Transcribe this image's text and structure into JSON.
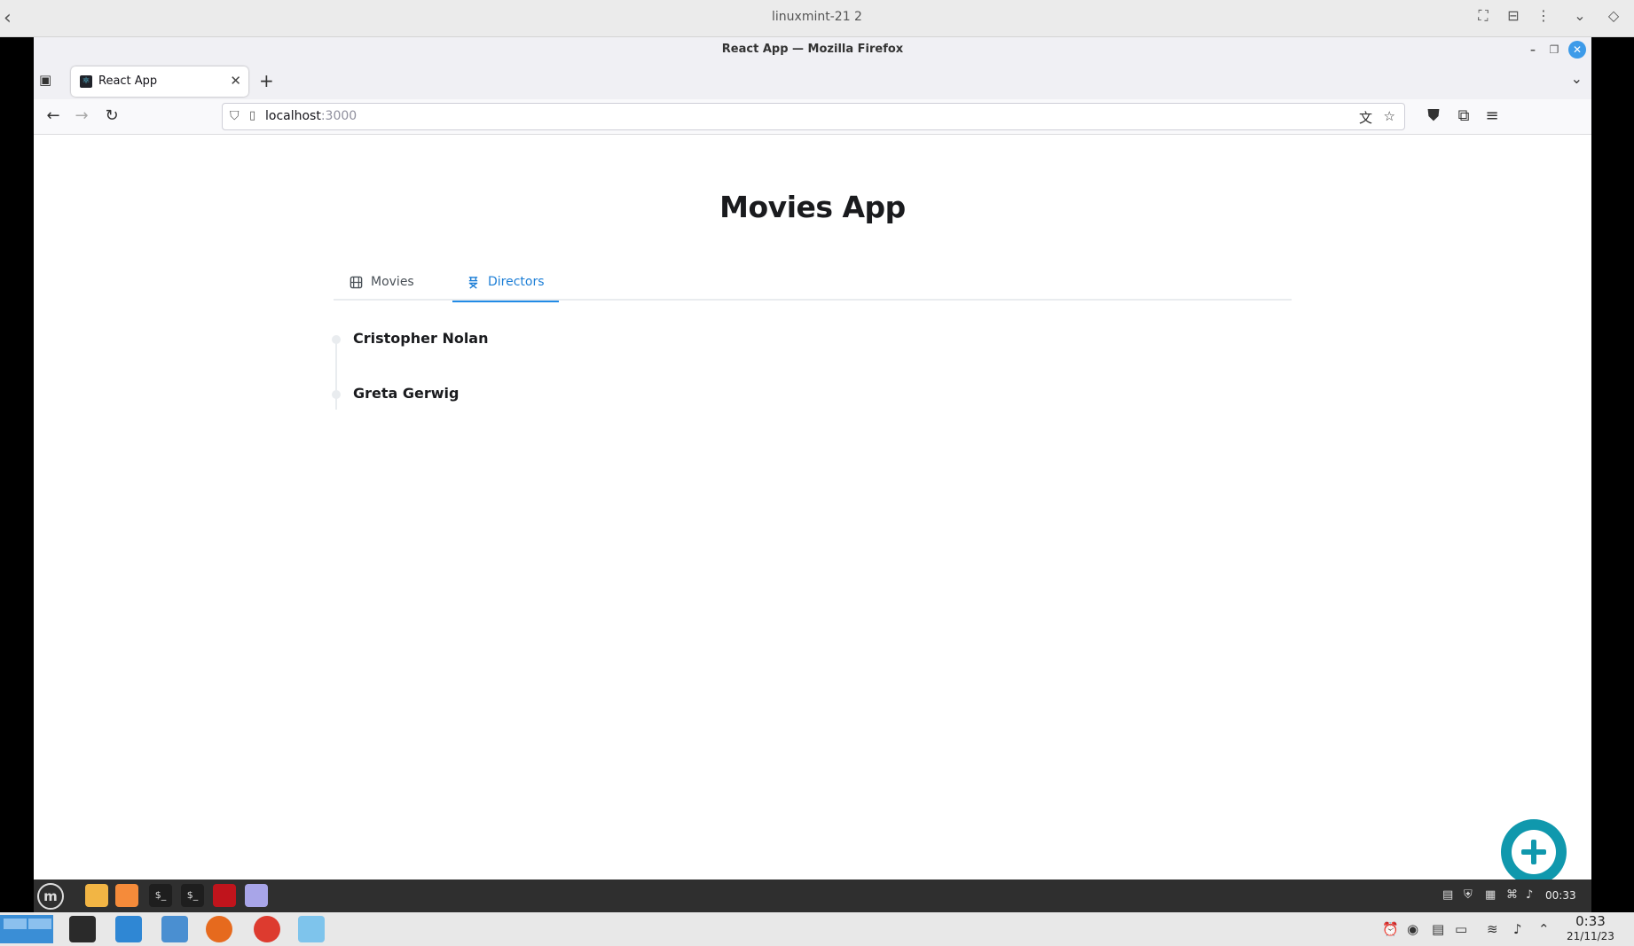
{
  "host": {
    "title": "linuxmint-21 2",
    "back_icon": "‹",
    "controls": [
      "⛶",
      "⊟",
      "⋮",
      "⌄",
      "◇"
    ]
  },
  "browser": {
    "window_title": "React App — Mozilla Firefox",
    "tab_title": "React App",
    "url_host": "localhost",
    "url_port": ":3000"
  },
  "app": {
    "title": "Movies App",
    "tabs": [
      {
        "label": "Movies",
        "icon": "film-icon",
        "active": false
      },
      {
        "label": "Directors",
        "icon": "director-chair-icon",
        "active": true
      }
    ],
    "directors": [
      {
        "name": "Cristopher Nolan"
      },
      {
        "name": "Greta Gerwig"
      }
    ],
    "accent_color": "#1098ad"
  },
  "guest_panel": {
    "clock": "00:33"
  },
  "host_taskbar": {
    "time": "0:33",
    "date": "21/11/23"
  }
}
